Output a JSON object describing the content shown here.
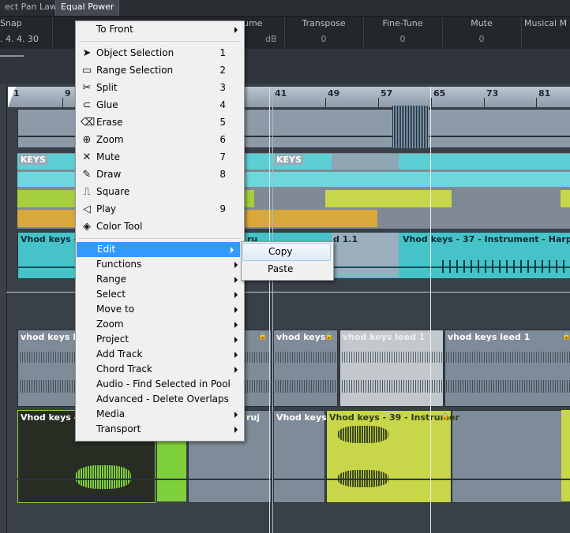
{
  "tabs": {
    "pan_law": "ect Pan Law",
    "equal_power": "Equal Power"
  },
  "info_line": {
    "snap": {
      "label": "Snap",
      "value": ". 4. 4. 30"
    },
    "volume": {
      "label": "ume",
      "value": "dB"
    },
    "transpose": {
      "label": "Transpose",
      "value": "0"
    },
    "fine_tune": {
      "label": "Fine-Tune",
      "value": "0"
    },
    "mute": {
      "label": "Mute",
      "value": "0"
    },
    "musical_mode": {
      "label": "Musical M"
    }
  },
  "ruler": {
    "ticks": [
      "1",
      "9",
      "41",
      "49",
      "57",
      "65",
      "73",
      "81"
    ]
  },
  "events": {
    "keys_a": "KEYS",
    "keys_b": "KEYS",
    "vhod_keys_3": "Vhod keys - 3",
    "instr_fragment": "ru",
    "leed_fragment": "d 1.1",
    "vhod_37_harp": "Vhod keys - 37 - Instrument - Harp",
    "vhod_leed_a": "vhod keys leed",
    "vhod_keys_mid": "vhod keys",
    "vhod_leed_1_grey": "vhod keys leed 1",
    "vhod_leed_1": "vhod keys leed 1",
    "vhod_keys_3_bottom": "Vhod keys - 3",
    "ruj_fragment": "ruj",
    "vhod_keys_b": "Vhod keys -",
    "vhod_39": "Vhod keys - 39 - Instrumer"
  },
  "context_menu": {
    "items": [
      {
        "label": "To Front",
        "shortcut": "",
        "submenu": true
      },
      {
        "label": "Object Selection",
        "shortcut": "1",
        "icon": "arrow-pointer-icon"
      },
      {
        "label": "Range Selection",
        "shortcut": "2",
        "icon": "range-selection-icon"
      },
      {
        "label": "Split",
        "shortcut": "3",
        "icon": "scissors-icon"
      },
      {
        "label": "Glue",
        "shortcut": "4",
        "icon": "glue-icon"
      },
      {
        "label": "Erase",
        "shortcut": "5",
        "icon": "eraser-icon"
      },
      {
        "label": "Zoom",
        "shortcut": "6",
        "icon": "magnifier-icon"
      },
      {
        "label": "Mute",
        "shortcut": "7",
        "icon": "mute-x-icon"
      },
      {
        "label": "Draw",
        "shortcut": "8",
        "icon": "pencil-icon"
      },
      {
        "label": "Square",
        "shortcut": "",
        "icon": "square-wave-icon"
      },
      {
        "label": "Play",
        "shortcut": "9",
        "icon": "speaker-icon"
      },
      {
        "label": "Color Tool",
        "shortcut": "",
        "icon": "paint-bucket-icon"
      },
      {
        "label": "Edit",
        "shortcut": "",
        "submenu": true
      },
      {
        "label": "Functions",
        "shortcut": "",
        "submenu": true
      },
      {
        "label": "Range",
        "shortcut": "",
        "submenu": true
      },
      {
        "label": "Select",
        "shortcut": "",
        "submenu": true
      },
      {
        "label": "Move to",
        "shortcut": "",
        "submenu": true
      },
      {
        "label": "Zoom",
        "shortcut": "",
        "submenu": true
      },
      {
        "label": "Project",
        "shortcut": "",
        "submenu": true
      },
      {
        "label": "Add Track",
        "shortcut": "",
        "submenu": true
      },
      {
        "label": "Chord Track",
        "shortcut": "",
        "submenu": true
      },
      {
        "label": "Audio - Find Selected in Pool",
        "shortcut": ""
      },
      {
        "label": "Advanced - Delete Overlaps",
        "shortcut": ""
      },
      {
        "label": "Media",
        "shortcut": "",
        "submenu": true
      },
      {
        "label": "Transport",
        "shortcut": "",
        "submenu": true
      }
    ]
  },
  "edit_submenu": {
    "copy": "Copy",
    "paste": "Paste"
  },
  "colors": {
    "cyan": "#5ccfd4",
    "yellow_green": "#c8d64a",
    "green": "#7fd13b",
    "orange": "#d8a83a",
    "highlight": "#3399ff"
  }
}
